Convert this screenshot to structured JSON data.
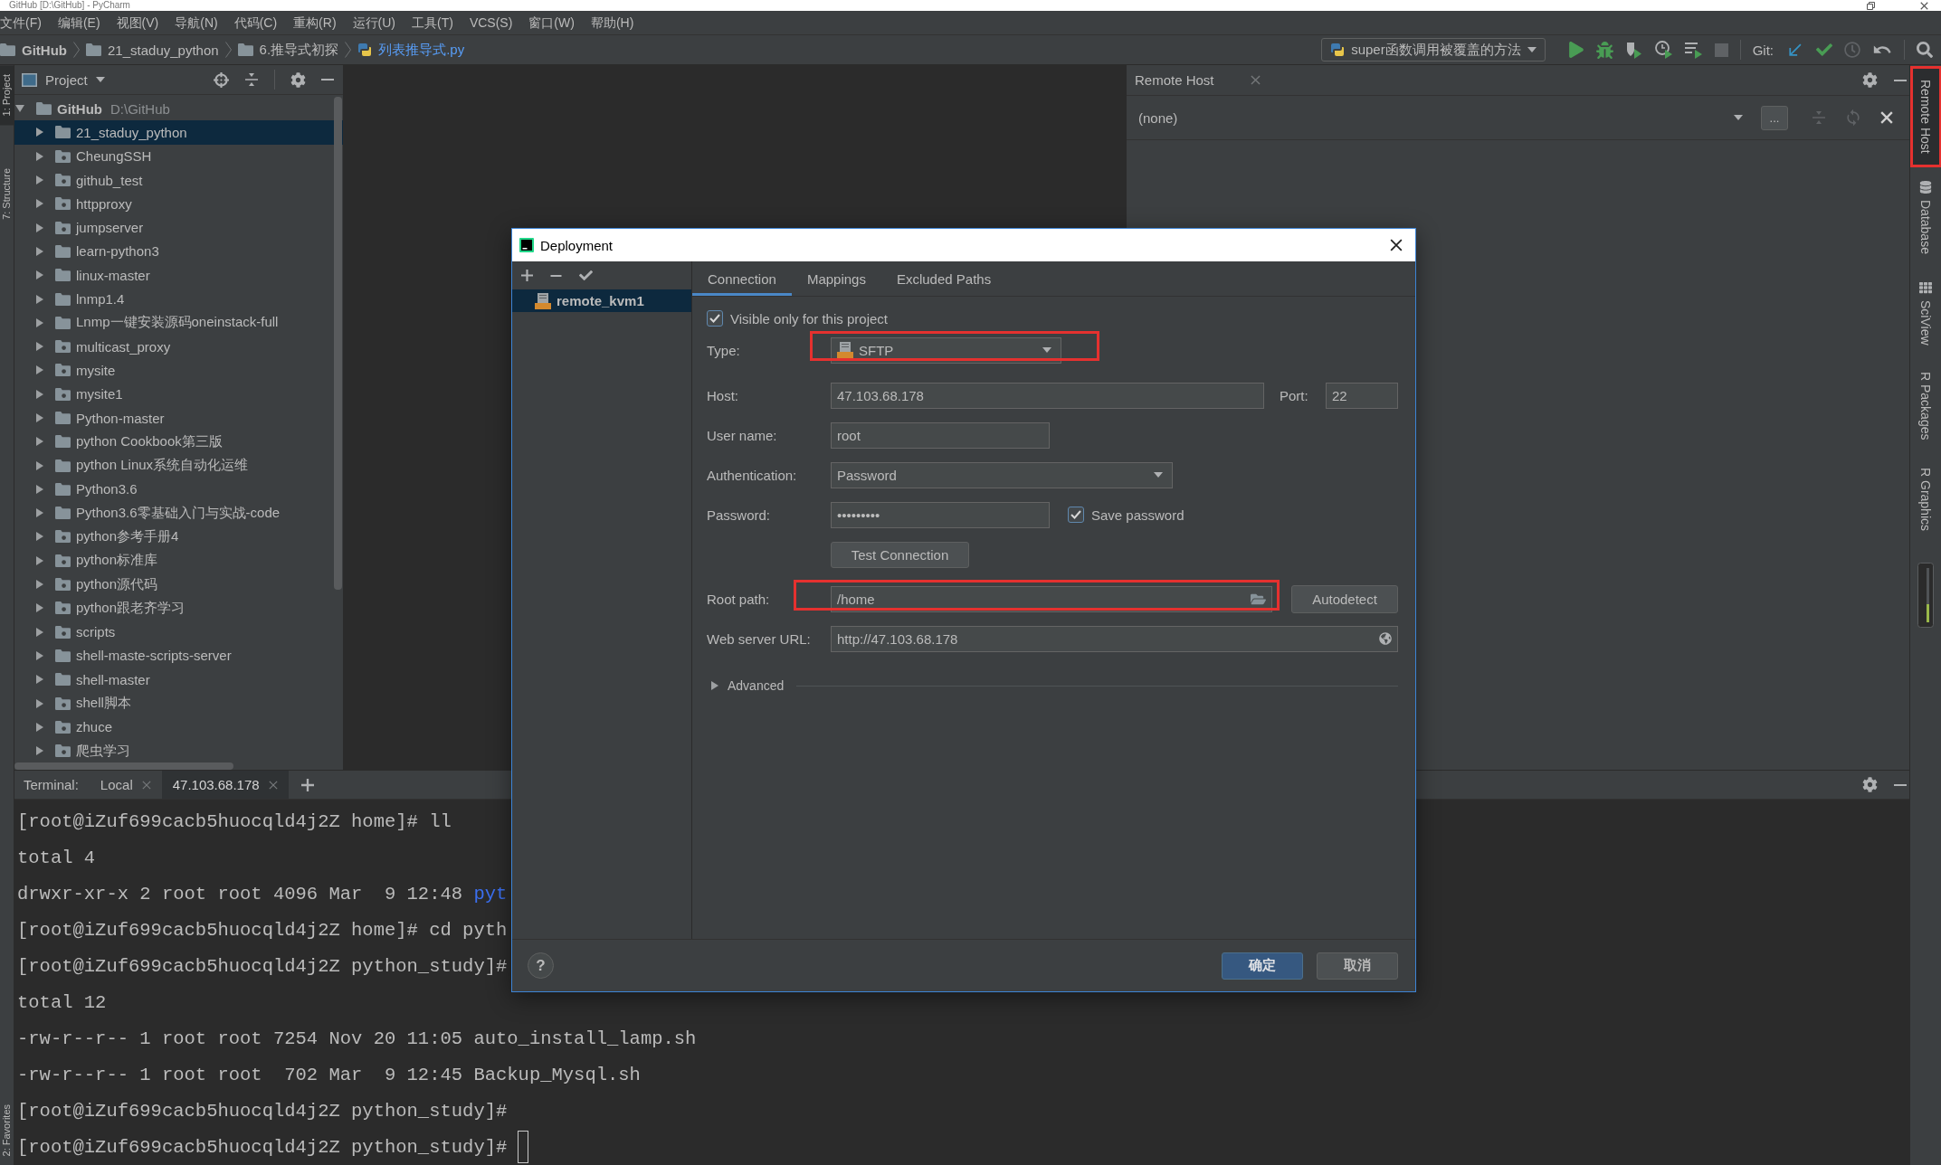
{
  "window": {
    "title": "GitHub [D:\\GitHub] - PyCharm"
  },
  "menu": [
    "文件(F)",
    "编辑(E)",
    "视图(V)",
    "导航(N)",
    "代码(C)",
    "重构(R)",
    "运行(U)",
    "工具(T)",
    "VCS(S)",
    "窗口(W)",
    "帮助(H)"
  ],
  "breadcrumbs": [
    {
      "label": "GitHub",
      "kind": "project"
    },
    {
      "label": "21_staduy_python",
      "kind": "folder"
    },
    {
      "label": "6.推导式初探",
      "kind": "folder"
    },
    {
      "label": "列表推导式.py",
      "kind": "python-file"
    }
  ],
  "toolbar": {
    "run_config": "super函数调用被覆盖的方法",
    "vcs_label": "Git:"
  },
  "left_tabs": {
    "top": [
      {
        "label": "1: Project",
        "selected": true
      },
      {
        "label": "7: Structure",
        "selected": false
      }
    ],
    "bottom": [
      {
        "label": "2: Favorites",
        "selected": false
      }
    ]
  },
  "project": {
    "title": "Project",
    "tree": [
      {
        "label": "GitHub",
        "path": "D:\\GitHub",
        "kind": "folder",
        "expanded": true,
        "selected": false,
        "children": [
          {
            "label": "21_staduy_python",
            "kind": "folder",
            "expanded": false,
            "selected": true
          },
          {
            "label": "CheungSSH",
            "kind": "module",
            "expanded": false,
            "selected": false
          },
          {
            "label": "github_test",
            "kind": "module",
            "expanded": false,
            "selected": false
          },
          {
            "label": "httpproxy",
            "kind": "module",
            "expanded": false,
            "selected": false
          },
          {
            "label": "jumpserver",
            "kind": "module",
            "expanded": false,
            "selected": false
          },
          {
            "label": "learn-python3",
            "kind": "folder",
            "expanded": false,
            "selected": false
          },
          {
            "label": "linux-master",
            "kind": "folder",
            "expanded": false,
            "selected": false
          },
          {
            "label": "lnmp1.4",
            "kind": "folder",
            "expanded": false,
            "selected": false
          },
          {
            "label": "Lnmp一键安装源码oneinstack-full",
            "kind": "folder",
            "expanded": false,
            "selected": false
          },
          {
            "label": "multicast_proxy",
            "kind": "module",
            "expanded": false,
            "selected": false
          },
          {
            "label": "mysite",
            "kind": "module",
            "expanded": false,
            "selected": false
          },
          {
            "label": "mysite1",
            "kind": "module",
            "expanded": false,
            "selected": false
          },
          {
            "label": "Python-master",
            "kind": "folder",
            "expanded": false,
            "selected": false
          },
          {
            "label": "python Cookbook第三版",
            "kind": "folder",
            "expanded": false,
            "selected": false
          },
          {
            "label": "python Linux系统自动化运维",
            "kind": "folder",
            "expanded": false,
            "selected": false
          },
          {
            "label": "Python3.6",
            "kind": "folder",
            "expanded": false,
            "selected": false
          },
          {
            "label": "Python3.6零基础入门与实战-code",
            "kind": "folder",
            "expanded": false,
            "selected": false
          },
          {
            "label": "python参考手册4",
            "kind": "module",
            "expanded": false,
            "selected": false
          },
          {
            "label": "python标准库",
            "kind": "module",
            "expanded": false,
            "selected": false
          },
          {
            "label": "python源代码",
            "kind": "module",
            "expanded": false,
            "selected": false
          },
          {
            "label": "python跟老齐学习",
            "kind": "module",
            "expanded": false,
            "selected": false
          },
          {
            "label": "scripts",
            "kind": "module",
            "expanded": false,
            "selected": false
          },
          {
            "label": "shell-maste-scripts-server",
            "kind": "folder",
            "expanded": false,
            "selected": false
          },
          {
            "label": "shell-master",
            "kind": "folder",
            "expanded": false,
            "selected": false
          },
          {
            "label": "shell脚本",
            "kind": "module",
            "expanded": false,
            "selected": false
          },
          {
            "label": "zhuce",
            "kind": "module",
            "expanded": false,
            "selected": false
          },
          {
            "label": "爬虫学习",
            "kind": "module",
            "expanded": false,
            "selected": false
          }
        ]
      }
    ]
  },
  "remote_host": {
    "title": "Remote Host",
    "server": "(none)",
    "more": "..."
  },
  "right_tabs": [
    {
      "label": "Remote Host",
      "kind": "plain",
      "selected": true,
      "highlighted": true
    },
    {
      "label": "Database",
      "kind": "database",
      "selected": false,
      "highlighted": false
    },
    {
      "label": "SciView",
      "kind": "grid",
      "selected": false,
      "highlighted": false
    },
    {
      "label": "R Packages",
      "kind": "plain",
      "selected": false,
      "highlighted": false
    },
    {
      "label": "R Graphics",
      "kind": "plain",
      "selected": false,
      "highlighted": false
    }
  ],
  "terminal": {
    "title": "Terminal:",
    "tabs": [
      {
        "label": "Local",
        "selected": false
      },
      {
        "label": "47.103.68.178",
        "selected": true
      }
    ],
    "lines": [
      {
        "segments": [
          {
            "text": "[root@iZuf699cacb5huocqld4j2Z home]# ll",
            "kind": "plain"
          }
        ],
        "cursor": false
      },
      {
        "segments": [
          {
            "text": "total 4",
            "kind": "plain"
          }
        ],
        "cursor": false
      },
      {
        "segments": [
          {
            "text": "drwxr-xr-x 2 root root 4096 Mar  9 12:48 ",
            "kind": "plain"
          },
          {
            "text": "pyt",
            "kind": "directory"
          }
        ],
        "cursor": false
      },
      {
        "segments": [
          {
            "text": "[root@iZuf699cacb5huocqld4j2Z home]# cd pyth",
            "kind": "plain"
          }
        ],
        "cursor": false
      },
      {
        "segments": [
          {
            "text": "[root@iZuf699cacb5huocqld4j2Z python_study]#",
            "kind": "plain"
          }
        ],
        "cursor": false
      },
      {
        "segments": [
          {
            "text": "total 12",
            "kind": "plain"
          }
        ],
        "cursor": false
      },
      {
        "segments": [
          {
            "text": "-rw-r--r-- 1 root root 7254 Nov 20 11:05 auto_install_lamp.sh",
            "kind": "plain"
          }
        ],
        "cursor": false
      },
      {
        "segments": [
          {
            "text": "-rw-r--r-- 1 root root  702 Mar  9 12:45 Backup_Mysql.sh",
            "kind": "plain"
          }
        ],
        "cursor": false
      },
      {
        "segments": [
          {
            "text": "[root@iZuf699cacb5huocqld4j2Z python_study]#",
            "kind": "plain"
          }
        ],
        "cursor": false
      },
      {
        "segments": [
          {
            "text": "[root@iZuf699cacb5huocqld4j2Z python_study]#",
            "kind": "plain"
          }
        ],
        "cursor": true
      }
    ]
  },
  "dialog": {
    "title": "Deployment",
    "servers": [
      {
        "name": "remote_kvm1",
        "selected": true
      }
    ],
    "tabs": [
      {
        "label": "Connection",
        "selected": true
      },
      {
        "label": "Mappings",
        "selected": false
      },
      {
        "label": "Excluded Paths",
        "selected": false
      }
    ],
    "visible_only": {
      "label": "Visible only for this project",
      "checked": true
    },
    "rows": [
      {
        "kind": "type",
        "label": "Type:",
        "value": "SFTP",
        "highlighted": true
      },
      {
        "kind": "host",
        "label": "Host:",
        "value": "47.103.68.178",
        "port_label": "Port:",
        "port": "22"
      },
      {
        "kind": "text",
        "label": "User name:",
        "value": "root"
      },
      {
        "kind": "choice",
        "label": "Authentication:",
        "value": "Password"
      },
      {
        "kind": "password",
        "label": "Password:",
        "value": "•••••••••",
        "save_label": "Save password",
        "save_checked": true
      },
      {
        "kind": "action",
        "label": "Test Connection"
      },
      {
        "kind": "path",
        "label": "Root path:",
        "value": "/home",
        "highlighted": true,
        "button": "Autodetect"
      },
      {
        "kind": "url",
        "label": "Web server URL:",
        "value": "http://47.103.68.178"
      }
    ],
    "advanced": {
      "label": "Advanced",
      "expanded": false
    },
    "help": "?",
    "buttons": [
      {
        "label": "确定",
        "kind": "primary"
      },
      {
        "label": "取消",
        "kind": "secondary"
      }
    ]
  }
}
